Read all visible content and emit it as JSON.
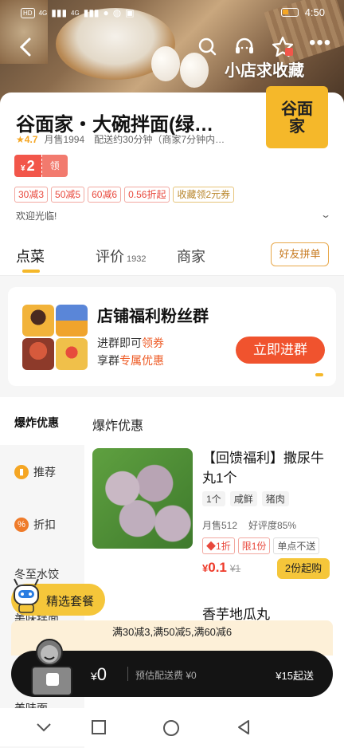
{
  "status": {
    "left_badges": [
      "HD",
      "4G",
      "4G"
    ],
    "time": "4:50"
  },
  "header": {
    "collect_text": "小店求收藏"
  },
  "shop": {
    "name": "谷面家・大碗拌面(绿…",
    "logo_text_top": "谷面",
    "logo_text_bottom": "家",
    "rating": "4.7",
    "monthly_sales": "月售1994",
    "delivery": "配送约30分钟（商家7分钟内…",
    "coupon": {
      "currency": "¥",
      "amount": "2",
      "get_label": "领"
    },
    "tags": [
      "30减3",
      "50减5",
      "60减6",
      "0.56折起",
      "收藏领2元券"
    ],
    "welcome": "欢迎光临!"
  },
  "tabs": [
    {
      "label": "点菜"
    },
    {
      "label": "评价",
      "count": "1932"
    },
    {
      "label": "商家"
    }
  ],
  "friend_button": "好友拼单",
  "fan_group": {
    "title": "店铺福利粉丝群",
    "line1_prefix": "进群即可",
    "line1_highlight": "领券",
    "line2_prefix": "享群",
    "line2_highlight": "专属优惠",
    "join_button": "立即进群"
  },
  "categories": [
    {
      "label": "爆炸优惠"
    },
    {
      "label": "推荐",
      "icon": "bookmark-icon"
    },
    {
      "label": "折扣",
      "icon": "discount-icon"
    },
    {
      "label": "冬至水饺"
    },
    {
      "label": "美味拌面"
    },
    {
      "label": "美味面"
    }
  ],
  "section_title": "爆炸优惠",
  "product": {
    "name": "【回馈福利】撒尿牛丸1个",
    "tags": [
      "1个",
      "咸鲜",
      "猪肉"
    ],
    "sales": "月售512",
    "rating": "好评度85%",
    "promos": [
      "1折",
      "限1份",
      "单点不送"
    ],
    "price_currency": "¥",
    "price": "0.1",
    "old_price": "¥1",
    "min_buy": "2份起购"
  },
  "next_product": {
    "name": "香芋地瓜丸"
  },
  "set_meal": "精选套餐",
  "promo_strip": "满30减3,满50减5,满60减6",
  "cart": {
    "currency": "¥",
    "total": "0",
    "delivery_fee": "预估配送费 ¥0",
    "min_order": "¥15起送"
  }
}
